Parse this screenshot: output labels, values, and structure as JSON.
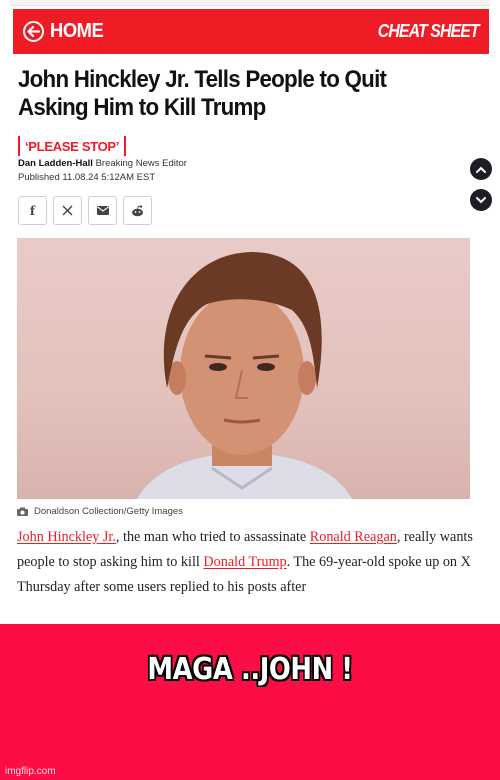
{
  "header": {
    "home_label": "HOME",
    "brand": "CHEAT SHEET",
    "accent_color": "#ef1c25"
  },
  "article": {
    "headline": "John Hinckley Jr. Tells People to Quit Asking Him to Kill Trump",
    "kicker": "‘PLEASE STOP’",
    "author": "Dan Ladden-Hall",
    "author_role": "Breaking News Editor",
    "published_label": "Published",
    "published_date": "11.08.24 5:12AM EST",
    "share_icons": [
      "facebook-icon",
      "x-icon",
      "mail-icon",
      "reddit-icon"
    ],
    "photo_caption": "Donaldson Collection/Getty Images",
    "body_parts": {
      "link1": "John Hinckley Jr.",
      "t1": ", the man who tried to assassinate ",
      "link2": "Ronald Reagan",
      "t2": ", really wants people to stop asking him to kill ",
      "link3": "Donald Trump",
      "t3": ". The 69-year-old spoke up on X Thursday after some users replied to his posts after"
    }
  },
  "scroll_controls": {
    "up_icon": "chevron-up-icon",
    "down_icon": "chevron-down-icon"
  },
  "meme": {
    "caption": "MAGA ..JOHN !",
    "watermark": "imgflip.com",
    "background_color": "#fb0e45"
  }
}
